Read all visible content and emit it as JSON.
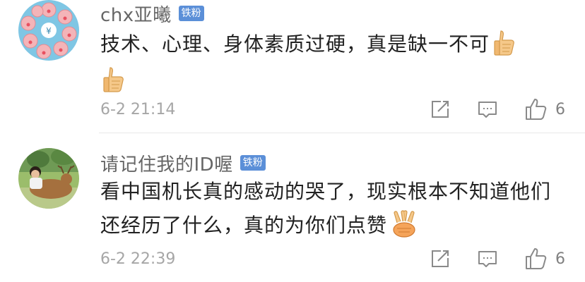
{
  "comments": [
    {
      "username": "chx亚曦",
      "badge": "铁粉",
      "text": "技术、心理、身体素质过硬，真是缺一不可",
      "emoji": "thumbs-up",
      "timestamp": "6-2 21:14",
      "likes": "6"
    },
    {
      "username": "请记住我的ID喔",
      "badge": "铁粉",
      "text": "看中国机长真的感动的哭了，现实根本不知道他们还经历了什么，真的为你们点赞",
      "emoji": "victory-hands",
      "timestamp": "6-2 22:39",
      "likes": "6"
    }
  ],
  "colors": {
    "badge": "#5b8fd8",
    "username": "#666666",
    "timestamp": "#a6a6a6",
    "icon": "#8a8a8a"
  }
}
